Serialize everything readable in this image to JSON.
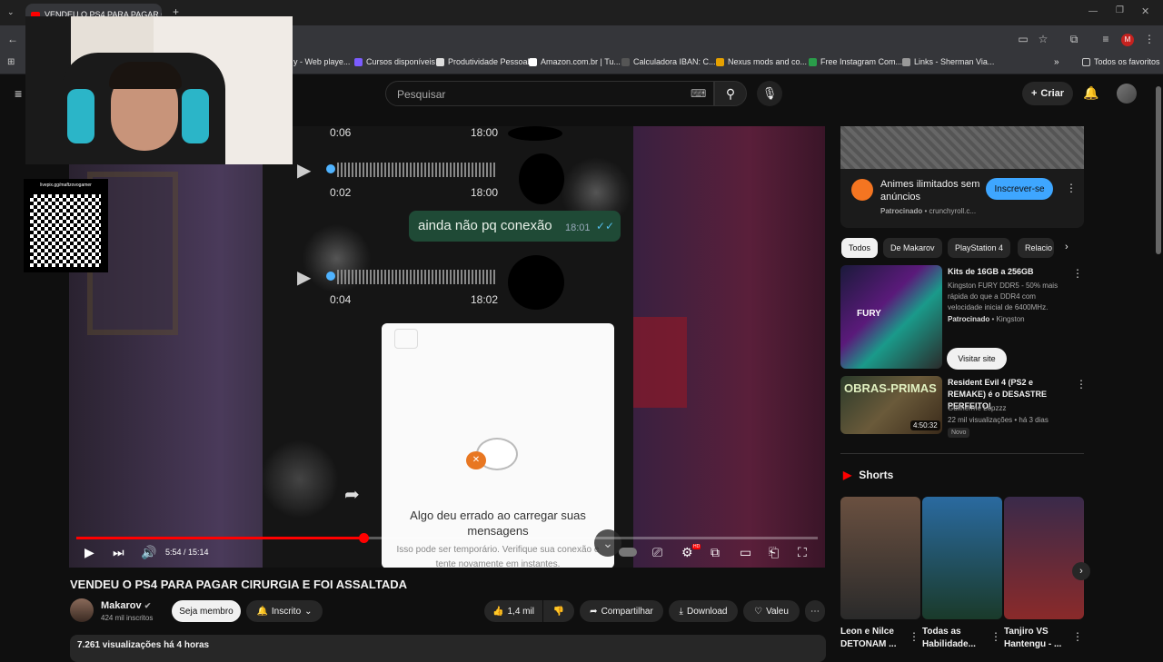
{
  "browser": {
    "tab_title": "VENDEU O PS4 PARA PAGAR C",
    "new_tab": "+",
    "bookmarks": [
      "y - Web playe...",
      "Cursos disponíveis",
      "Produtividade Pessoal",
      "Amazon.com.br | Tu...",
      "Calculadora IBAN: C...",
      "Nexus mods and co...",
      "Free Instagram Com...",
      "Links - Sherman Via..."
    ],
    "all_bookmarks": "Todos os favoritos",
    "more_bookmarks": "»",
    "profile_initial": "M"
  },
  "header": {
    "search_placeholder": "Pesquisar",
    "create": "Criar"
  },
  "overlay": {
    "qr_label": "livepix.gg/maftzovogamer"
  },
  "player": {
    "audio1_time": "0:06",
    "audio1_clock": "18:00",
    "audio2_time": "0:02",
    "audio2_clock": "18:00",
    "bubble_text": "ainda não pq conexão",
    "bubble_time": "18:01",
    "audio3_time": "0:04",
    "audio3_clock": "18:02",
    "error_title": "Algo deu errado ao carregar suas mensagens",
    "error_sub": "Isso pode ser temporário. Verifique sua conexão e tente novamente em instantes.",
    "time_display": "5:54 / 15:14",
    "progress": 0.387
  },
  "video": {
    "title": "VENDEU O PS4 PARA PAGAR CIRURGIA E FOI ASSALTADA",
    "channel": "Makarov",
    "subscribers": "424 mil inscritos",
    "member": "Seja membro",
    "subscribed": "Inscrito",
    "likes": "1,4 mil",
    "share": "Compartilhar",
    "download": "Download",
    "thanks": "Valeu",
    "views": "7.261 visualizações",
    "age": "há 4 horas"
  },
  "sidebar": {
    "ad": {
      "title": "Animes ilimitados sem anúncios",
      "sponsored": "Patrocinado",
      "domain": "crunchyroll.c...",
      "cta": "Inscrever-se"
    },
    "chips": [
      "Todos",
      "De Makarov",
      "PlayStation 4",
      "Relacio"
    ],
    "promo": {
      "title": "Kits de 16GB a 256GB",
      "desc": "Kingston FURY DDR5 - 50% mais rápida do que a DDR4 com velocidade inicial de 6400MHz.",
      "sponsored": "Patrocinado",
      "brand": "Kingston",
      "cta": "Visitar site",
      "thumb_text": "FURY"
    },
    "rec": {
      "title": "Resident Evil 4 (PS2 e REMAKE) é o DESASTRE PERFEITO!",
      "channel": "Guilherme Lopzzz",
      "meta": "22 mil visualizações",
      "age": "há 3 dias",
      "badge": "Novo",
      "duration": "4:50:32",
      "thumb_text": "OBRAS-PRIMAS"
    },
    "shorts_title": "Shorts",
    "shorts": [
      {
        "title": "Leon e Nilce DETONAM ..."
      },
      {
        "title": "Todas as Habilidade..."
      },
      {
        "title": "Tanjiro VS Hantengu - ..."
      }
    ]
  }
}
